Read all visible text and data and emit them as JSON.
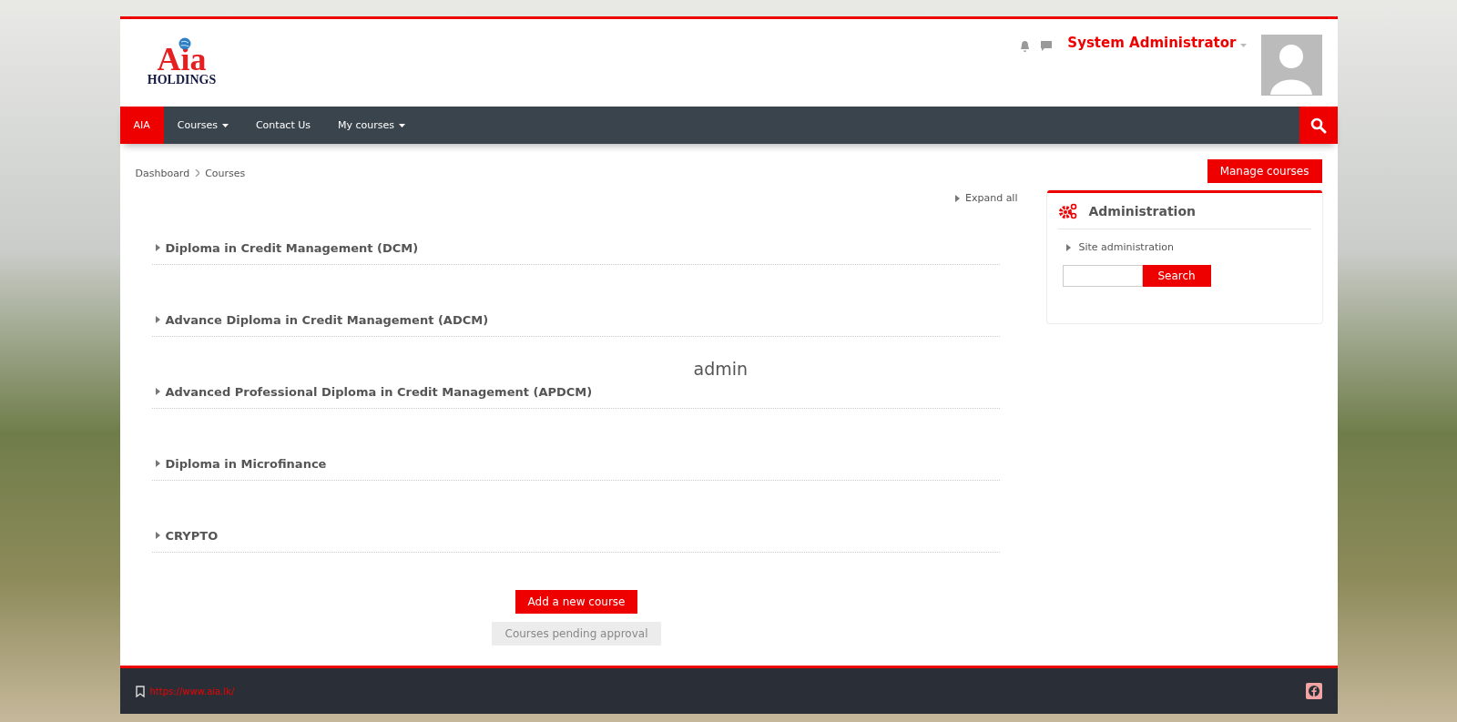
{
  "logo": {
    "main": "Aia",
    "sub": "HOLDINGS"
  },
  "user_menu": {
    "name": "System Administrator"
  },
  "nav": {
    "items": [
      {
        "label": "AIA",
        "selected": true,
        "dropdown": false
      },
      {
        "label": "Courses",
        "selected": false,
        "dropdown": true
      },
      {
        "label": "Contact Us",
        "selected": false,
        "dropdown": false
      },
      {
        "label": "My courses",
        "selected": false,
        "dropdown": true
      }
    ]
  },
  "breadcrumb": [
    "Dashboard",
    "Courses"
  ],
  "manage_button": "Manage courses",
  "expand_all": "Expand all",
  "courses": [
    {
      "name": "Diploma in Credit Management (DCM)",
      "expanded": false
    },
    {
      "name": "Advance Diploma in Credit Management (ADCM)",
      "expanded": false
    },
    {
      "name": "Advanced Professional Diploma in Credit Management (APDCM)",
      "expanded": false
    },
    {
      "name": "Diploma in Microfinance",
      "expanded": false
    },
    {
      "name": "CRYPTO",
      "expanded": false
    }
  ],
  "overlay_text": "admin",
  "add_button": "Add a new course",
  "pending_button": "Courses pending approval",
  "admin_block": {
    "title": "Administration",
    "items": [
      {
        "label": "Site administration",
        "expanded": false
      }
    ],
    "search_button": "Search"
  },
  "footer": {
    "link": "https://www.aia.lk/"
  }
}
